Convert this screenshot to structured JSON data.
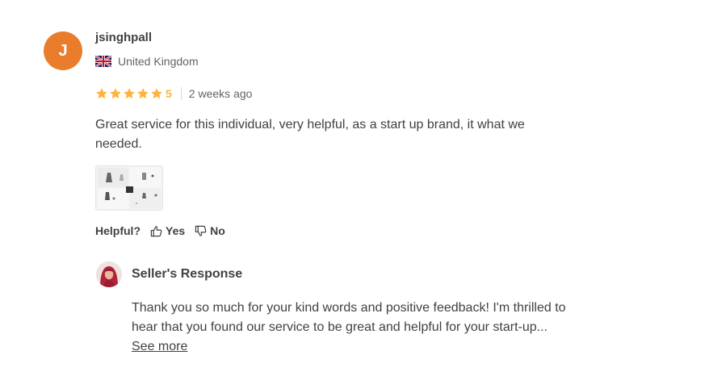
{
  "review": {
    "avatar_initial": "J",
    "avatar_color": "#e97d2c",
    "username": "jsinghpall",
    "country": "United Kingdom",
    "country_flag_icon": "uk-flag-icon",
    "rating": 5,
    "rating_label": "5",
    "star_color": "#ffb33e",
    "time_ago": "2 weeks ago",
    "text_line1": "Great service for this individual, very helpful, as a start up brand, it what we",
    "text_line2": "needed."
  },
  "helpful": {
    "label": "Helpful?",
    "yes_label": "Yes",
    "no_label": "No",
    "yes_icon": "thumbs-up-icon",
    "no_icon": "thumbs-down-icon"
  },
  "seller_response": {
    "title": "Seller's Response",
    "text_line1": "Thank you so much for your kind words and positive feedback! I'm thrilled to",
    "text_line2": "hear that you found our service to be great and helpful for your start-up...",
    "see_more_label": "See more"
  }
}
